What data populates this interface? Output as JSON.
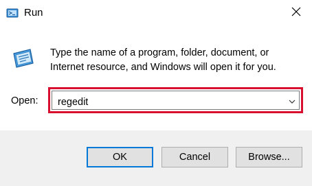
{
  "window": {
    "title": "Run",
    "icons": {
      "app": "run-app-icon",
      "close": "close-icon"
    }
  },
  "content": {
    "description": "Type the name of a program, folder, document, or Internet resource, and Windows will open it for you.",
    "open_label": "Open:",
    "open_value": "regedit",
    "highlight_color": "#d90f2f"
  },
  "buttons": {
    "ok": "OK",
    "cancel": "Cancel",
    "browse": "Browse..."
  }
}
